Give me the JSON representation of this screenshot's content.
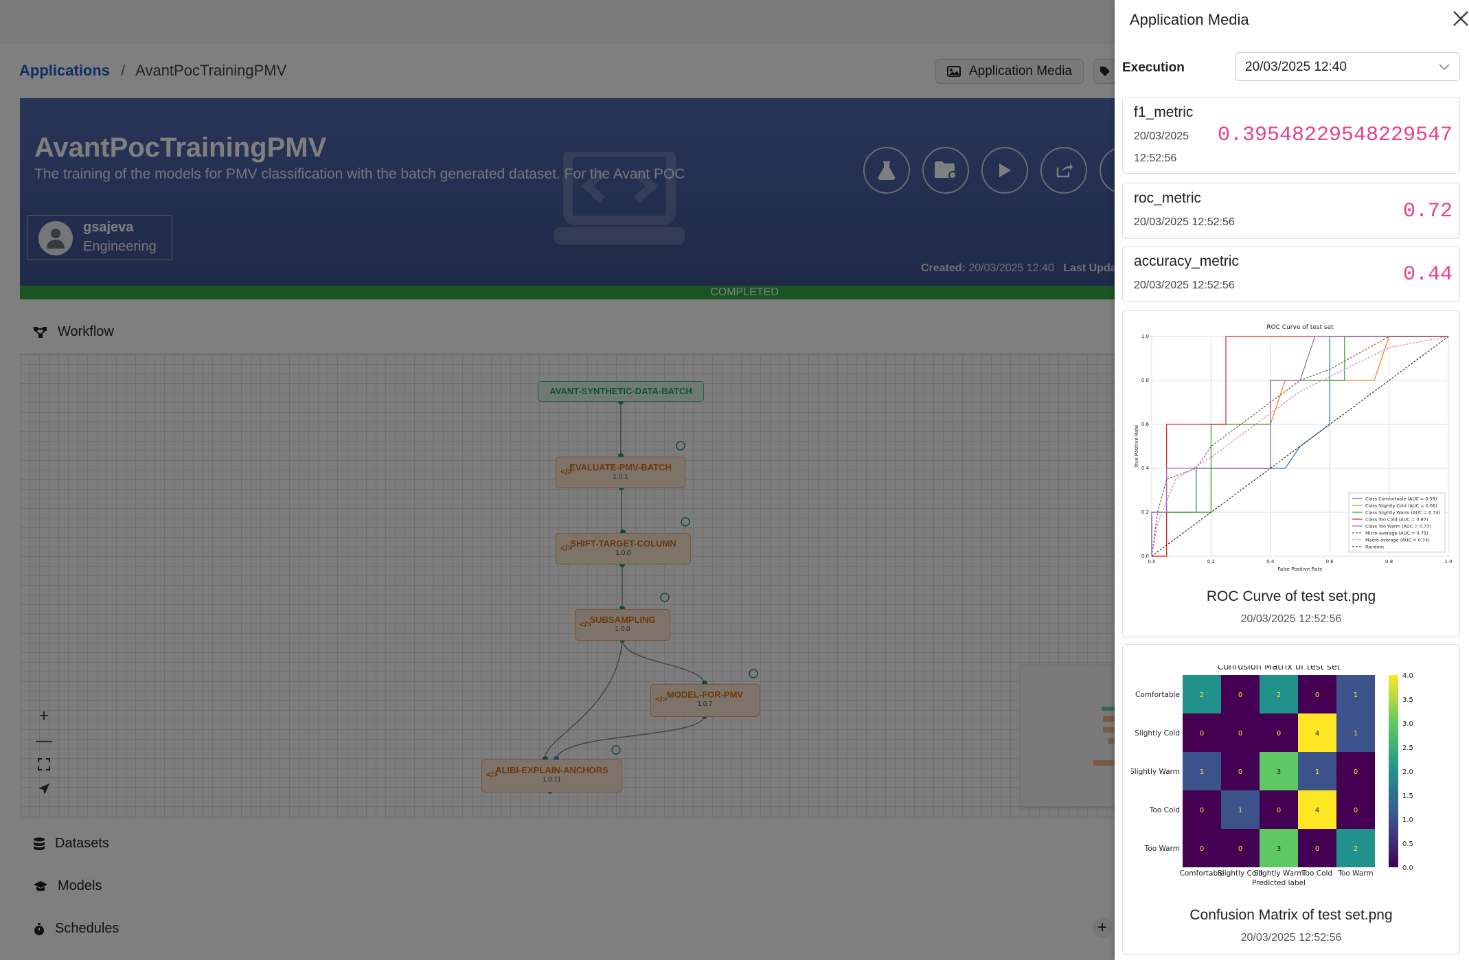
{
  "breadcrumb": {
    "root": "Applications",
    "separator": "/",
    "current": "AvantPocTrainingPMV"
  },
  "header_buttons": {
    "media": "Application Media"
  },
  "app": {
    "title": "AvantPocTrainingPMV",
    "description": "The training of the models for PMV classification with the batch generated dataset. For the Avant POC",
    "user": {
      "name": "gsajeva",
      "department": "Engineering"
    },
    "created_label": "Created:",
    "created_value": "20/03/2025 12:40",
    "last_updated_label": "Last Updat",
    "status": "COMPLETED"
  },
  "sections": {
    "workflow": "Workflow",
    "datasets": "Datasets",
    "models": "Models",
    "schedules": "Schedules"
  },
  "workflow_nodes": [
    {
      "name": "AVANT-SYNTHETIC-DATA-BATCH",
      "version": ""
    },
    {
      "name": "EVALUATE-PMV-BATCH",
      "version": "1.0.1"
    },
    {
      "name": "SHIFT-TARGET-COLUMN",
      "version": "1.0.0"
    },
    {
      "name": "SUBSAMPLING",
      "version": "1.0.0"
    },
    {
      "name": "MODEL-FOR-PMV",
      "version": "1.0.7"
    },
    {
      "name": "ALIBI-EXPLAIN-ANCHORS",
      "version": "1.0.11"
    }
  ],
  "zoom_controls": {
    "plus": "+",
    "minus": "—"
  },
  "drawer": {
    "title": "Application Media",
    "execution_label": "Execution",
    "execution_value": "20/03/2025 12:40",
    "metrics": [
      {
        "name": "f1_metric",
        "date": "20/03/2025",
        "time": "12:52:56",
        "value": "0.39548229548229547"
      },
      {
        "name": "roc_metric",
        "date": "20/03/2025 12:52:56",
        "value": "0.72"
      },
      {
        "name": "accuracy_metric",
        "date": "20/03/2025 12:52:56",
        "value": "0.44"
      }
    ],
    "media": [
      {
        "name": "ROC Curve of test set.png",
        "date": "20/03/2025 12:52:56"
      },
      {
        "name": "Confusion Matrix of test set.png",
        "date": "20/03/2025 12:52:56"
      }
    ]
  },
  "roc_image": {
    "title": "ROC Curve of test set",
    "xlabel": "False Positive Rate",
    "ylabel": "True Positive Rate",
    "ticks": [
      "0.0",
      "0.2",
      "0.4",
      "0.6",
      "0.8",
      "1.0"
    ],
    "legend": [
      {
        "label": "Class Comfortable (AUC = 0.59)",
        "color": "#1f77b4",
        "dash": false
      },
      {
        "label": "Class Slightly Cold (AUC = 0.66)",
        "color": "#ff7f0e",
        "dash": false
      },
      {
        "label": "Class Slightly Warm (AUC = 0.74)",
        "color": "#2ca02c",
        "dash": false
      },
      {
        "label": "Class Too Cold (AUC = 0.87)",
        "color": "#d62728",
        "dash": false
      },
      {
        "label": "Class Too Warm (AUC = 0.73)",
        "color": "#9467bd",
        "dash": false
      },
      {
        "label": "Micro-average (AUC = 0.75)",
        "color": "#8c564b",
        "dash": true
      },
      {
        "label": "Macro-average (AUC = 0.74)",
        "color": "#e377c2",
        "dash": true
      },
      {
        "label": "Random",
        "color": "#333333",
        "dash": true
      }
    ]
  },
  "confusion_image": {
    "title": "Confusion Matrix of test set",
    "xlabel": "Predicted label",
    "labels": [
      "Comfortable",
      "Slightly Cold",
      "Slightly Warm",
      "Too Cold",
      "Too Warm"
    ],
    "matrix": [
      [
        2,
        0,
        2,
        0,
        1
      ],
      [
        0,
        0,
        0,
        4,
        1
      ],
      [
        1,
        0,
        3,
        1,
        0
      ],
      [
        0,
        1,
        0,
        4,
        0
      ],
      [
        0,
        0,
        3,
        0,
        2
      ]
    ],
    "colorbar_ticks": [
      "4.0",
      "3.5",
      "3.0",
      "2.5",
      "2.0",
      "1.5",
      "1.0",
      "0.5",
      "0.0"
    ]
  }
}
